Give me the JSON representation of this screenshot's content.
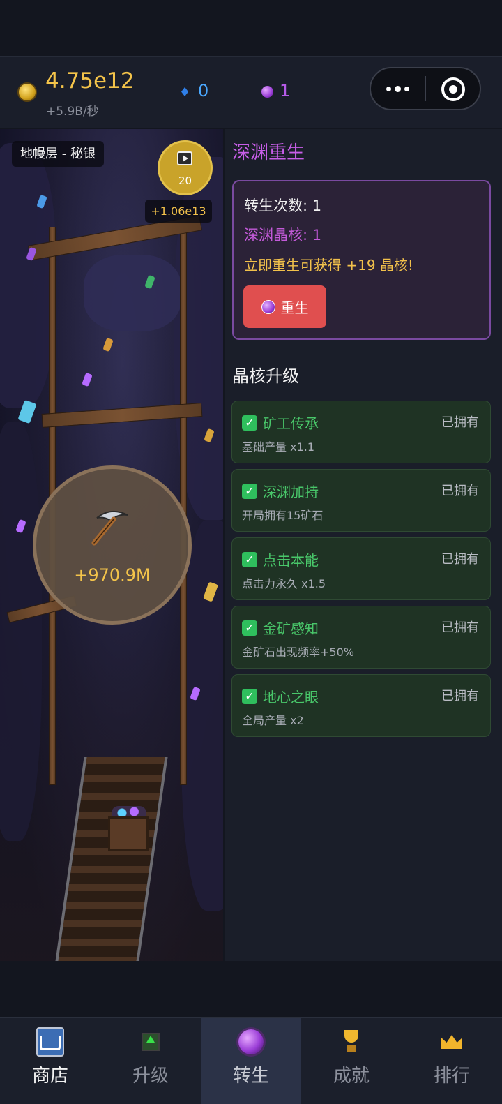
{
  "header": {
    "gold_value": "4.75e12",
    "gold_rate": "+5.9B/秒",
    "blue_gems": "0",
    "purple_gems": "1",
    "icons": {
      "gold": "gold-coin-icon",
      "blue": "blue-diamond-icon",
      "purple": "purple-orb-icon",
      "more": "more-dots-icon",
      "close": "mini-program-close-icon"
    }
  },
  "mine": {
    "layer_label": "地幔层 - 秘银",
    "video_count": "20",
    "video_reward": "+1.06e13",
    "click_value": "+970.9M"
  },
  "rebirth": {
    "title": "深渊重生",
    "count_text": "转生次数: 1",
    "core_text": "深渊晶核: 1",
    "gain_text": "立即重生可获得 +19 晶核!",
    "button_label": "重生"
  },
  "upgrades": {
    "title": "晶核升级",
    "items": [
      {
        "name": "矿工传承",
        "desc": "基础产量 x1.1",
        "status": "已拥有"
      },
      {
        "name": "深渊加持",
        "desc": "开局拥有15矿石",
        "status": "已拥有"
      },
      {
        "name": "点击本能",
        "desc": "点击力永久 x1.5",
        "status": "已拥有"
      },
      {
        "name": "金矿感知",
        "desc": "金矿石出现频率+50%",
        "status": "已拥有"
      },
      {
        "name": "地心之眼",
        "desc": "全局产量 x2",
        "status": "已拥有"
      }
    ]
  },
  "nav": {
    "items": [
      {
        "label": "商店",
        "icon": "shop-cart-icon"
      },
      {
        "label": "升级",
        "icon": "upgrade-arrow-icon"
      },
      {
        "label": "转生",
        "icon": "rebirth-orb-icon"
      },
      {
        "label": "成就",
        "icon": "trophy-icon"
      },
      {
        "label": "排行",
        "icon": "crown-icon"
      }
    ],
    "active_index": 2
  },
  "colors": {
    "gold": "#f4c44a",
    "purple_accent": "#c85ee8",
    "green_owned": "#49c76a",
    "rebirth_button": "#e04f4f"
  }
}
